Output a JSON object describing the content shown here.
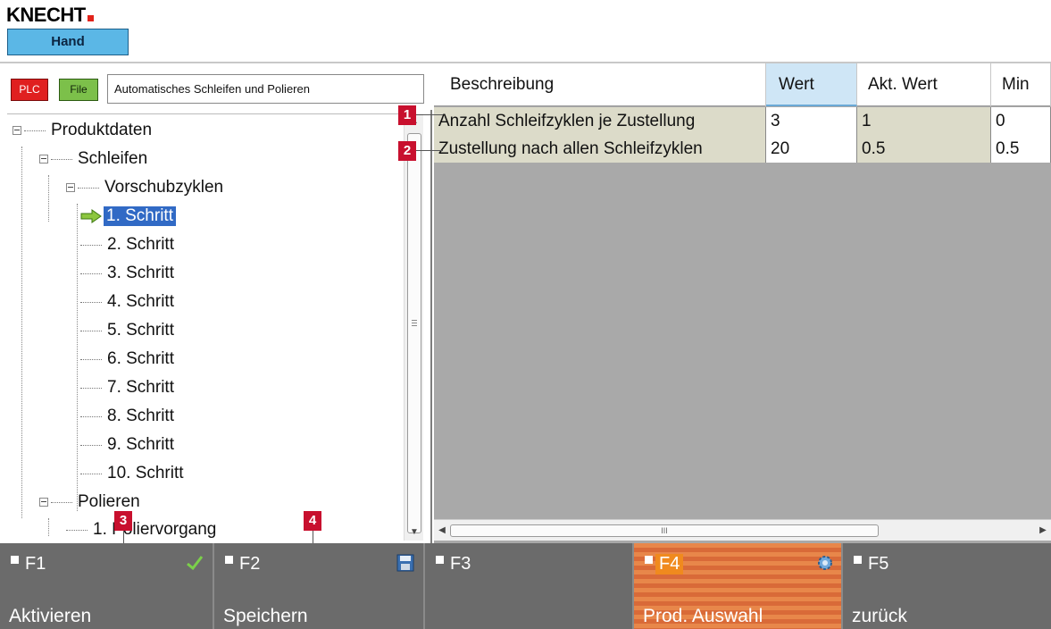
{
  "header": {
    "logo_text": "KNECHT",
    "mode": "Hand"
  },
  "toolbar": {
    "plc_label": "PLC",
    "file_label": "File",
    "program_title": "Automatisches Schleifen und Polieren"
  },
  "tree": {
    "root": "Produktdaten",
    "grinding": "Schleifen",
    "feed_cycles": "Vorschubzyklen",
    "steps": [
      "1. Schritt",
      "2. Schritt",
      "3. Schritt",
      "4. Schritt",
      "5. Schritt",
      "6. Schritt",
      "7. Schritt",
      "8. Schritt",
      "9. Schritt",
      "10. Schritt"
    ],
    "selected_step_index": 0,
    "polishing": "Polieren",
    "polishing_process": "Poliervorgang",
    "polishing_process_prefix": "1."
  },
  "grid": {
    "columns": [
      "Beschreibung",
      "Wert",
      "Akt. Wert",
      "Min"
    ],
    "active_column": "Wert",
    "rows": [
      {
        "description": "Anzahl Schleifzyklen je Zustellung",
        "value": "3",
        "actual": "1",
        "min": "0"
      },
      {
        "description": "Zustellung nach allen Schleifzyklen",
        "value": "20",
        "actual": "0.5",
        "min": "0.5"
      }
    ],
    "hscroll_grip": "III"
  },
  "callouts": [
    "1",
    "2",
    "3",
    "4"
  ],
  "function_keys": [
    {
      "id": "F1",
      "label": "Aktivieren",
      "icon": "check-icon"
    },
    {
      "id": "F2",
      "label": "Speichern",
      "icon": "save-icon"
    },
    {
      "id": "F3",
      "label": "",
      "icon": ""
    },
    {
      "id": "F4",
      "label": "Prod. Auswahl",
      "icon": "gear-icon",
      "active": true
    },
    {
      "id": "F5",
      "label": "zurück",
      "icon": ""
    }
  ],
  "colors": {
    "plc": "#e02020",
    "file": "#7cc04a",
    "selection": "#316ac5",
    "callout": "#c8102e",
    "active_fkey": "#e8874a"
  }
}
